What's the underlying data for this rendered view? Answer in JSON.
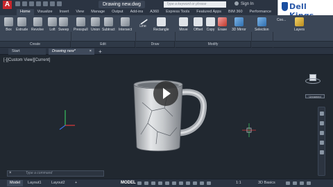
{
  "app": {
    "icon_label": "A"
  },
  "title": {
    "document": "Drawing new.dwg"
  },
  "search": {
    "placeholder": "Type a keyword or phrase"
  },
  "signin": {
    "label": "Sign In"
  },
  "watermark": {
    "text": "Dell Kings"
  },
  "ribbon_tabs": [
    "Home",
    "Visualize",
    "Insert",
    "View",
    "Manage",
    "Output",
    "Add-ins",
    "A360",
    "Express Tools",
    "Featured Apps",
    "BIM 360",
    "Performance"
  ],
  "tools": {
    "box": "Box",
    "extrude": "Extrude",
    "revolve": "Revolve",
    "loft": "Loft",
    "sweep": "Sweep",
    "presspull": "Presspull",
    "union": "Union",
    "subtract": "Subtract",
    "intersect": "Intersect",
    "line": "Line",
    "rectangle": "Rectangle",
    "move": "Move",
    "offset": "Offset",
    "copy": "Copy",
    "erase": "Erase",
    "mirror3d": "3D Mirror",
    "selection": "Selection",
    "coordinates": "Coo...",
    "layers": "Layers"
  },
  "panels": {
    "create": "Create",
    "edit": "Edit",
    "draw": "Draw",
    "modify": "Modify"
  },
  "file_tabs": {
    "start": "Start",
    "current": "Drawing new*",
    "close": "×",
    "add": "+"
  },
  "viewport": {
    "label": "[-][Custom View][Current]",
    "view_name": "Unnamed"
  },
  "command": {
    "close": "×",
    "placeholder": "Type a command"
  },
  "layout_tabs": {
    "model": "Model",
    "layout1": "Layout1",
    "layout2": "Layout2",
    "add": "+"
  },
  "status": {
    "model": "MODEL",
    "scale": "1:1",
    "workspace": "3D Basics"
  },
  "colors": {
    "app_red": "#c8262c",
    "axis_red": "#e03a3a",
    "axis_green": "#38c060",
    "axis_blue": "#3a6fe0"
  }
}
